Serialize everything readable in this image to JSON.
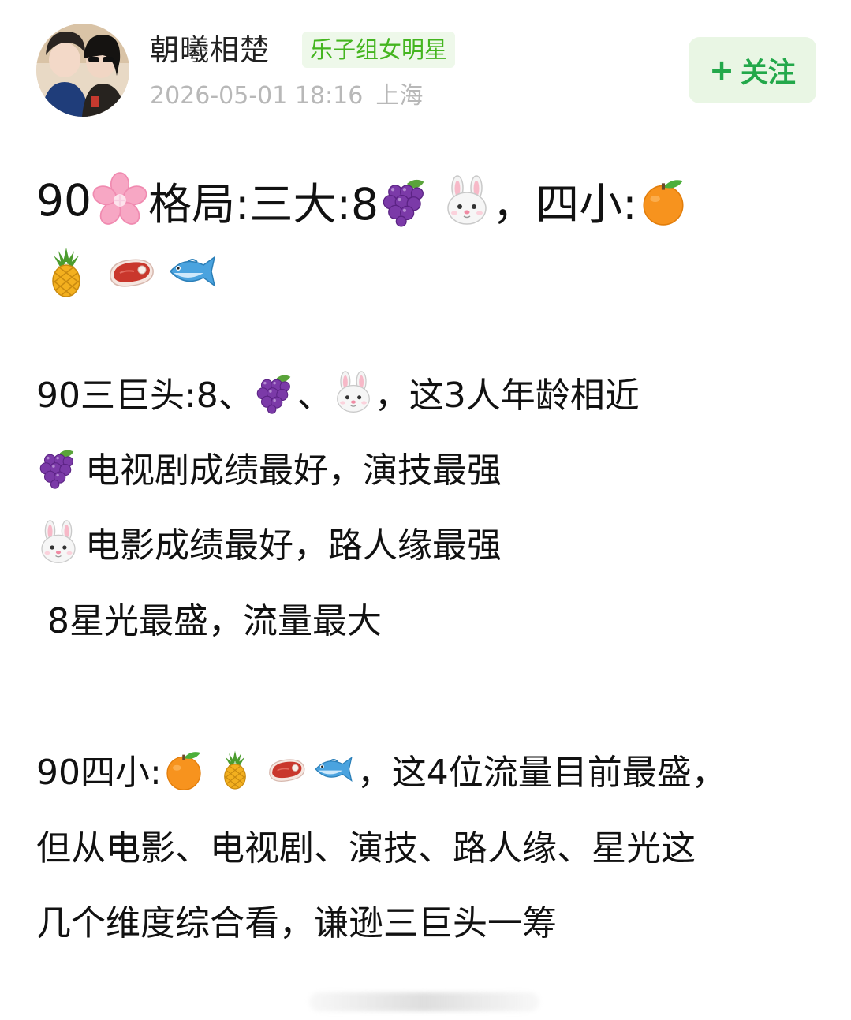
{
  "author": {
    "name": "朝曦相楚",
    "badge": "乐子组女明星",
    "date": "2026-05-01 18:16",
    "location": "上海"
  },
  "follow_button": {
    "plus": "+",
    "label": "关注"
  },
  "post": {
    "l1": {
      "a": "90",
      "b": "格局:三大:8",
      "c": "，四小:"
    },
    "l3": {
      "a": "90三巨头:8、",
      "b": "、",
      "c": "，这3人年龄相近"
    },
    "l4": {
      "a": "电视剧成绩最好，演技最强"
    },
    "l5": {
      "a": "电影成绩最好，路人缘最强"
    },
    "l6": {
      "a": " 8星光最盛，流量最大"
    },
    "l7": {
      "a": "90四小:",
      "b": "，这4位流量目前最盛，"
    },
    "l8": {
      "a": "但从电影、电视剧、演技、路人缘、星光这"
    },
    "l9": {
      "a": "几个维度综合看，谦逊三巨头一筹"
    }
  },
  "icons": [
    "cherry-blossom-icon",
    "grapes-icon",
    "rabbit-face-icon",
    "tangerine-icon",
    "pineapple-icon",
    "meat-icon",
    "fish-icon"
  ]
}
